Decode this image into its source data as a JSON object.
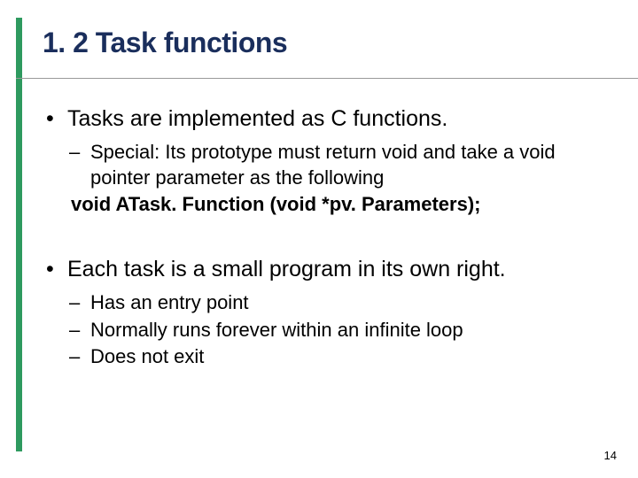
{
  "title": "1. 2 Task functions",
  "bullets": [
    {
      "text": "Tasks are implemented as C functions.",
      "sub": [
        "Special: Its prototype must return void and take a void pointer parameter as the following"
      ],
      "code": "void ATask. Function (void *pv. Parameters);"
    },
    {
      "text": "Each task is a small program in its own right.",
      "sub": [
        "Has an entry point",
        "Normally runs forever within an infinite loop",
        "Does not exit"
      ]
    }
  ],
  "page_number": "14"
}
